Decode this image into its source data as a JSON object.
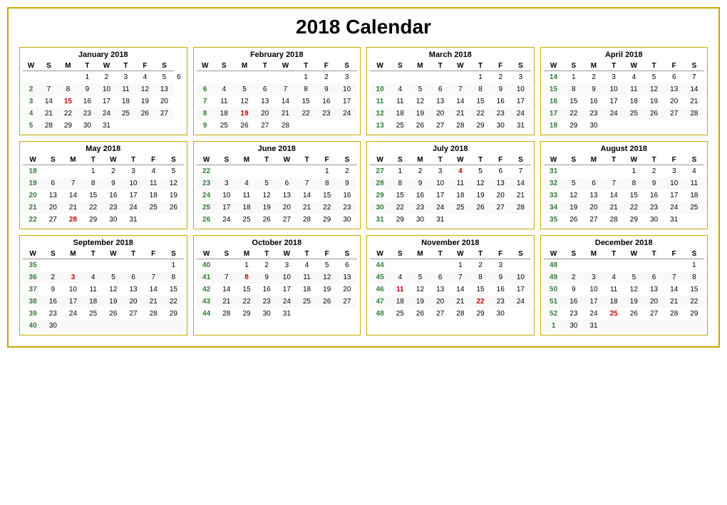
{
  "title": "2018 Calendar",
  "months": [
    {
      "name": "January 2018",
      "weeks": [
        {
          "wn": "",
          "days": [
            "",
            "",
            "1",
            "2",
            "3",
            "4",
            "5",
            "6"
          ]
        },
        {
          "wn": "2",
          "days": [
            "7",
            "8",
            "9",
            "10",
            "11",
            "12",
            "13"
          ]
        },
        {
          "wn": "3",
          "days": [
            "14",
            "15",
            "16",
            "17",
            "18",
            "19",
            "20"
          ]
        },
        {
          "wn": "4",
          "days": [
            "21",
            "22",
            "23",
            "24",
            "25",
            "26",
            "27"
          ]
        },
        {
          "wn": "5",
          "days": [
            "28",
            "29",
            "30",
            "31",
            "",
            "",
            ""
          ]
        }
      ],
      "special": {
        "15": "red"
      }
    },
    {
      "name": "February 2018",
      "weeks": [
        {
          "wn": "",
          "days": [
            "",
            "",
            "",
            "",
            "1",
            "2",
            "3"
          ]
        },
        {
          "wn": "6",
          "days": [
            "4",
            "5",
            "6",
            "7",
            "8",
            "9",
            "10"
          ]
        },
        {
          "wn": "7",
          "days": [
            "11",
            "12",
            "13",
            "14",
            "15",
            "16",
            "17"
          ]
        },
        {
          "wn": "8",
          "days": [
            "18",
            "19",
            "20",
            "21",
            "22",
            "23",
            "24"
          ]
        },
        {
          "wn": "9",
          "days": [
            "25",
            "26",
            "27",
            "28",
            "",
            "",
            ""
          ]
        }
      ],
      "special": {
        "5": "green",
        "19": "red"
      }
    },
    {
      "name": "March 2018",
      "weeks": [
        {
          "wn": "",
          "days": [
            "",
            "",
            "",
            "",
            "1",
            "2",
            "3"
          ]
        },
        {
          "wn": "10",
          "days": [
            "4",
            "5",
            "6",
            "7",
            "8",
            "9",
            "10"
          ]
        },
        {
          "wn": "11",
          "days": [
            "11",
            "12",
            "13",
            "14",
            "15",
            "16",
            "17"
          ]
        },
        {
          "wn": "12",
          "days": [
            "18",
            "19",
            "20",
            "21",
            "22",
            "23",
            "24"
          ]
        },
        {
          "wn": "13",
          "days": [
            "25",
            "26",
            "27",
            "28",
            "29",
            "30",
            "31"
          ]
        }
      ],
      "special": {}
    },
    {
      "name": "April 2018",
      "weeks": [
        {
          "wn": "14",
          "days": [
            "1",
            "2",
            "3",
            "4",
            "5",
            "6",
            "7"
          ]
        },
        {
          "wn": "15",
          "days": [
            "8",
            "9",
            "10",
            "11",
            "12",
            "13",
            "14"
          ]
        },
        {
          "wn": "16",
          "days": [
            "15",
            "16",
            "17",
            "18",
            "19",
            "20",
            "21"
          ]
        },
        {
          "wn": "17",
          "days": [
            "22",
            "23",
            "24",
            "25",
            "26",
            "27",
            "28"
          ]
        },
        {
          "wn": "18",
          "days": [
            "29",
            "30",
            "",
            "",
            "",
            "",
            ""
          ]
        }
      ],
      "special": {}
    },
    {
      "name": "May 2018",
      "weeks": [
        {
          "wn": "18",
          "days": [
            "",
            "",
            "1",
            "2",
            "3",
            "4",
            "5"
          ]
        },
        {
          "wn": "19",
          "days": [
            "6",
            "7",
            "8",
            "9",
            "10",
            "11",
            "12"
          ]
        },
        {
          "wn": "20",
          "days": [
            "13",
            "14",
            "15",
            "16",
            "17",
            "18",
            "19"
          ]
        },
        {
          "wn": "21",
          "days": [
            "20",
            "21",
            "22",
            "23",
            "24",
            "25",
            "26"
          ]
        },
        {
          "wn": "22",
          "days": [
            "27",
            "28",
            "29",
            "30",
            "31",
            "",
            ""
          ]
        }
      ],
      "special": {
        "28": "red"
      }
    },
    {
      "name": "June 2018",
      "weeks": [
        {
          "wn": "22",
          "days": [
            "",
            "",
            "",
            "",
            "",
            "1",
            "2"
          ]
        },
        {
          "wn": "23",
          "days": [
            "3",
            "4",
            "5",
            "6",
            "7",
            "8",
            "9"
          ]
        },
        {
          "wn": "24",
          "days": [
            "10",
            "11",
            "12",
            "13",
            "14",
            "15",
            "16"
          ]
        },
        {
          "wn": "25",
          "days": [
            "17",
            "18",
            "19",
            "20",
            "21",
            "22",
            "23"
          ]
        },
        {
          "wn": "26",
          "days": [
            "24",
            "25",
            "26",
            "27",
            "28",
            "29",
            "30"
          ]
        }
      ],
      "special": {}
    },
    {
      "name": "July 2018",
      "weeks": [
        {
          "wn": "27",
          "days": [
            "1",
            "2",
            "3",
            "4",
            "5",
            "6",
            "7"
          ]
        },
        {
          "wn": "28",
          "days": [
            "8",
            "9",
            "10",
            "11",
            "12",
            "13",
            "14"
          ]
        },
        {
          "wn": "29",
          "days": [
            "15",
            "16",
            "17",
            "18",
            "19",
            "20",
            "21"
          ]
        },
        {
          "wn": "30",
          "days": [
            "22",
            "23",
            "24",
            "25",
            "26",
            "27",
            "28"
          ]
        },
        {
          "wn": "31",
          "days": [
            "29",
            "30",
            "31",
            "",
            "",
            "",
            ""
          ]
        }
      ],
      "special": {
        "4": "red"
      }
    },
    {
      "name": "August 2018",
      "weeks": [
        {
          "wn": "31",
          "days": [
            "",
            "",
            "",
            "1",
            "2",
            "3",
            "4"
          ]
        },
        {
          "wn": "32",
          "days": [
            "5",
            "6",
            "7",
            "8",
            "9",
            "10",
            "11"
          ]
        },
        {
          "wn": "33",
          "days": [
            "12",
            "13",
            "14",
            "15",
            "16",
            "17",
            "18"
          ]
        },
        {
          "wn": "34",
          "days": [
            "19",
            "20",
            "21",
            "22",
            "23",
            "24",
            "25"
          ]
        },
        {
          "wn": "35",
          "days": [
            "26",
            "27",
            "28",
            "29",
            "30",
            "31",
            ""
          ]
        }
      ],
      "special": {}
    },
    {
      "name": "September 2018",
      "weeks": [
        {
          "wn": "35",
          "days": [
            "",
            "",
            "",
            "",
            "",
            "",
            "1"
          ]
        },
        {
          "wn": "36",
          "days": [
            "2",
            "3",
            "4",
            "5",
            "6",
            "7",
            "8"
          ]
        },
        {
          "wn": "37",
          "days": [
            "9",
            "10",
            "11",
            "12",
            "13",
            "14",
            "15"
          ]
        },
        {
          "wn": "38",
          "days": [
            "16",
            "17",
            "18",
            "19",
            "20",
            "21",
            "22"
          ]
        },
        {
          "wn": "39",
          "days": [
            "23",
            "24",
            "25",
            "26",
            "27",
            "28",
            "29"
          ]
        },
        {
          "wn": "40",
          "days": [
            "30",
            "",
            "",
            "",
            "",
            "",
            ""
          ]
        }
      ],
      "special": {
        "3": "red"
      }
    },
    {
      "name": "October 2018",
      "weeks": [
        {
          "wn": "40",
          "days": [
            "",
            "1",
            "2",
            "3",
            "4",
            "5",
            "6"
          ]
        },
        {
          "wn": "41",
          "days": [
            "7",
            "8",
            "9",
            "10",
            "11",
            "12",
            "13"
          ]
        },
        {
          "wn": "42",
          "days": [
            "14",
            "15",
            "16",
            "17",
            "18",
            "19",
            "20"
          ]
        },
        {
          "wn": "43",
          "days": [
            "21",
            "22",
            "23",
            "24",
            "25",
            "26",
            "27"
          ]
        },
        {
          "wn": "44",
          "days": [
            "28",
            "29",
            "30",
            "31",
            "",
            "",
            ""
          ]
        }
      ],
      "special": {
        "8": "red"
      }
    },
    {
      "name": "November 2018",
      "weeks": [
        {
          "wn": "44",
          "days": [
            "",
            "",
            "",
            "1",
            "2",
            "3"
          ]
        },
        {
          "wn": "45",
          "days": [
            "4",
            "5",
            "6",
            "7",
            "8",
            "9",
            "10"
          ]
        },
        {
          "wn": "46",
          "days": [
            "11",
            "12",
            "13",
            "14",
            "15",
            "16",
            "17"
          ]
        },
        {
          "wn": "47",
          "days": [
            "18",
            "19",
            "20",
            "21",
            "22",
            "23",
            "24"
          ]
        },
        {
          "wn": "48",
          "days": [
            "25",
            "26",
            "27",
            "28",
            "29",
            "30",
            ""
          ]
        }
      ],
      "special": {
        "11": "red",
        "22": "red"
      }
    },
    {
      "name": "December 2018",
      "weeks": [
        {
          "wn": "48",
          "days": [
            "",
            "",
            "",
            "",
            "",
            "",
            "1"
          ]
        },
        {
          "wn": "49",
          "days": [
            "2",
            "3",
            "4",
            "5",
            "6",
            "7",
            "8"
          ]
        },
        {
          "wn": "50",
          "days": [
            "9",
            "10",
            "11",
            "12",
            "13",
            "14",
            "15"
          ]
        },
        {
          "wn": "51",
          "days": [
            "16",
            "17",
            "18",
            "19",
            "20",
            "21",
            "22"
          ]
        },
        {
          "wn": "52",
          "days": [
            "23",
            "24",
            "25",
            "26",
            "27",
            "28",
            "29"
          ]
        },
        {
          "wn": "1",
          "days": [
            "30",
            "31",
            "",
            "",
            "",
            "",
            ""
          ]
        }
      ],
      "special": {
        "25": "red"
      }
    }
  ],
  "headers": [
    "W",
    "S",
    "M",
    "T",
    "W",
    "T",
    "F",
    "S"
  ]
}
